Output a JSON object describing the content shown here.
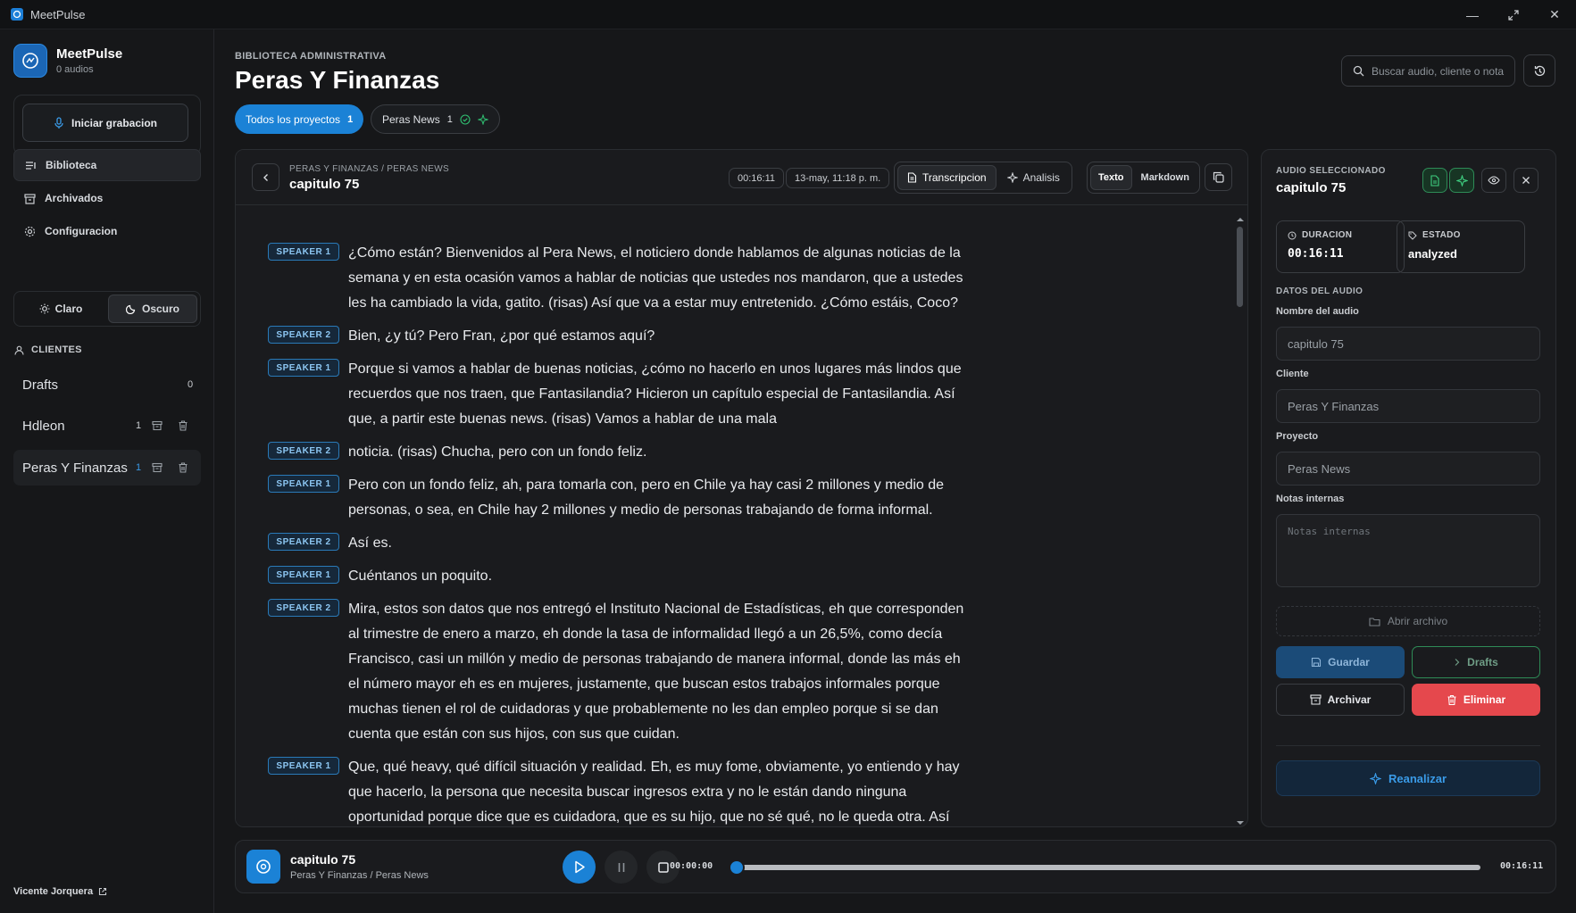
{
  "window": {
    "title": "MeetPulse"
  },
  "brand": {
    "name": "MeetPulse",
    "subtitle": "0 audios"
  },
  "sidebar": {
    "record_label": "Iniciar grabacion",
    "nav": [
      {
        "label": "Biblioteca",
        "icon": "library-icon",
        "active": true
      },
      {
        "label": "Archivados",
        "icon": "archive-icon",
        "active": false
      },
      {
        "label": "Configuracion",
        "icon": "gear-icon",
        "active": false
      }
    ],
    "theme": {
      "light": "Claro",
      "dark": "Oscuro",
      "selected": "Oscuro"
    },
    "clients_heading": "CLIENTES",
    "clients": [
      {
        "name": "Drafts",
        "count": "0",
        "active": false
      },
      {
        "name": "Hdleon",
        "count": "1",
        "active": false
      },
      {
        "name": "Peras Y Finanzas",
        "count": "1",
        "active": true
      }
    ],
    "user": "Vicente Jorquera"
  },
  "header": {
    "eyebrow": "BIBLIOTECA ADMINISTRATIVA",
    "title": "Peras Y Finanzas",
    "filters": [
      {
        "label": "Todos los proyectos",
        "count": "1",
        "active": true
      },
      {
        "label": "Peras News",
        "count": "1",
        "active": false
      }
    ],
    "search_placeholder": "Buscar audio, cliente o nota"
  },
  "viewer": {
    "breadcrumb": "PERAS Y FINANZAS / PERAS NEWS",
    "title": "capitulo 75",
    "duration_chip": "00:16:11",
    "date_chip": "13-may, 11:18 p. m.",
    "tabs": [
      {
        "label": "Transcripcion",
        "active": true
      },
      {
        "label": "Analisis",
        "active": false
      }
    ],
    "formats": [
      {
        "label": "Texto",
        "active": true
      },
      {
        "label": "Markdown",
        "active": false
      }
    ],
    "segments": [
      {
        "speaker": "SPEAKER 1",
        "text": "¿Cómo están? Bienvenidos al Pera News, el noticiero donde hablamos de algunas noticias de la semana y en esta ocasión vamos a hablar de noticias que ustedes nos mandaron, que a ustedes les ha cambiado la vida, gatito. (risas) Así que va a estar muy entretenido. ¿Cómo estáis, Coco?"
      },
      {
        "speaker": "SPEAKER 2",
        "text": "Bien, ¿y tú? Pero Fran, ¿por qué estamos aquí?"
      },
      {
        "speaker": "SPEAKER 1",
        "text": "Porque si vamos a hablar de buenas noticias, ¿cómo no hacerlo en unos lugares más lindos que recuerdos que nos traen, que Fantasilandia? Hicieron un capítulo especial de Fantasilandia. Así que, a partir este buenas news. (risas) Vamos a hablar de una mala"
      },
      {
        "speaker": "SPEAKER 2",
        "text": "noticia. (risas) Chucha, pero con un fondo feliz."
      },
      {
        "speaker": "SPEAKER 1",
        "text": "Pero con un fondo feliz, ah, para tomarla con, pero en Chile ya hay casi 2 millones y medio de personas, o sea, en Chile hay 2 millones y medio de personas trabajando de forma informal."
      },
      {
        "speaker": "SPEAKER 2",
        "text": "Así es."
      },
      {
        "speaker": "SPEAKER 1",
        "text": "Cuéntanos un poquito."
      },
      {
        "speaker": "SPEAKER 2",
        "text": "Mira, estos son datos que nos entregó el Instituto Nacional de Estadísticas, eh que corresponden al trimestre de enero a marzo, eh donde la tasa de informalidad llegó a un 26,5%, como decía Francisco, casi un millón y medio de personas trabajando de manera informal, donde las más eh el número mayor eh es en mujeres, justamente, que buscan estos trabajos informales porque muchas tienen el rol de cuidadoras y que probablemente no les dan empleo porque si se dan cuenta que están con sus hijos, con sus que cuidan."
      },
      {
        "speaker": "SPEAKER 1",
        "text": "Que, qué heavy, qué difícil situación y realidad. Eh, es muy fome, obviamente, yo entiendo y hay que hacerlo, la persona que necesita buscar ingresos extra y no le están dando ninguna oportunidad porque dice que es cuidadora, que es su hijo, que no sé qué, no le queda otra. Así que"
      }
    ]
  },
  "details": {
    "eyebrow": "AUDIO SELECCIONADO",
    "title": "capitulo 75",
    "duration_label": "DURACION",
    "duration_value": "00:16:11",
    "status_label": "ESTADO",
    "status_value": "analyzed",
    "section_label": "DATOS DEL AUDIO",
    "name_label": "Nombre del audio",
    "name_value": "capitulo 75",
    "client_label": "Cliente",
    "client_value": "Peras Y Finanzas",
    "project_label": "Proyecto",
    "project_value": "Peras News",
    "notes_label": "Notas internas",
    "notes_placeholder": "Notas internas",
    "open_file": "Abrir archivo",
    "save": "Guardar",
    "drafts": "Drafts",
    "archive": "Archivar",
    "delete": "Eliminar",
    "reanalyze": "Reanalizar"
  },
  "player": {
    "title": "capitulo 75",
    "subtitle": "Peras Y Finanzas / Peras News",
    "current_time": "00:00:00",
    "total_time": "00:16:11",
    "progress": 0
  },
  "colors": {
    "accent": "#1b82d6",
    "danger": "#e5484d",
    "success": "#2e8b57"
  }
}
